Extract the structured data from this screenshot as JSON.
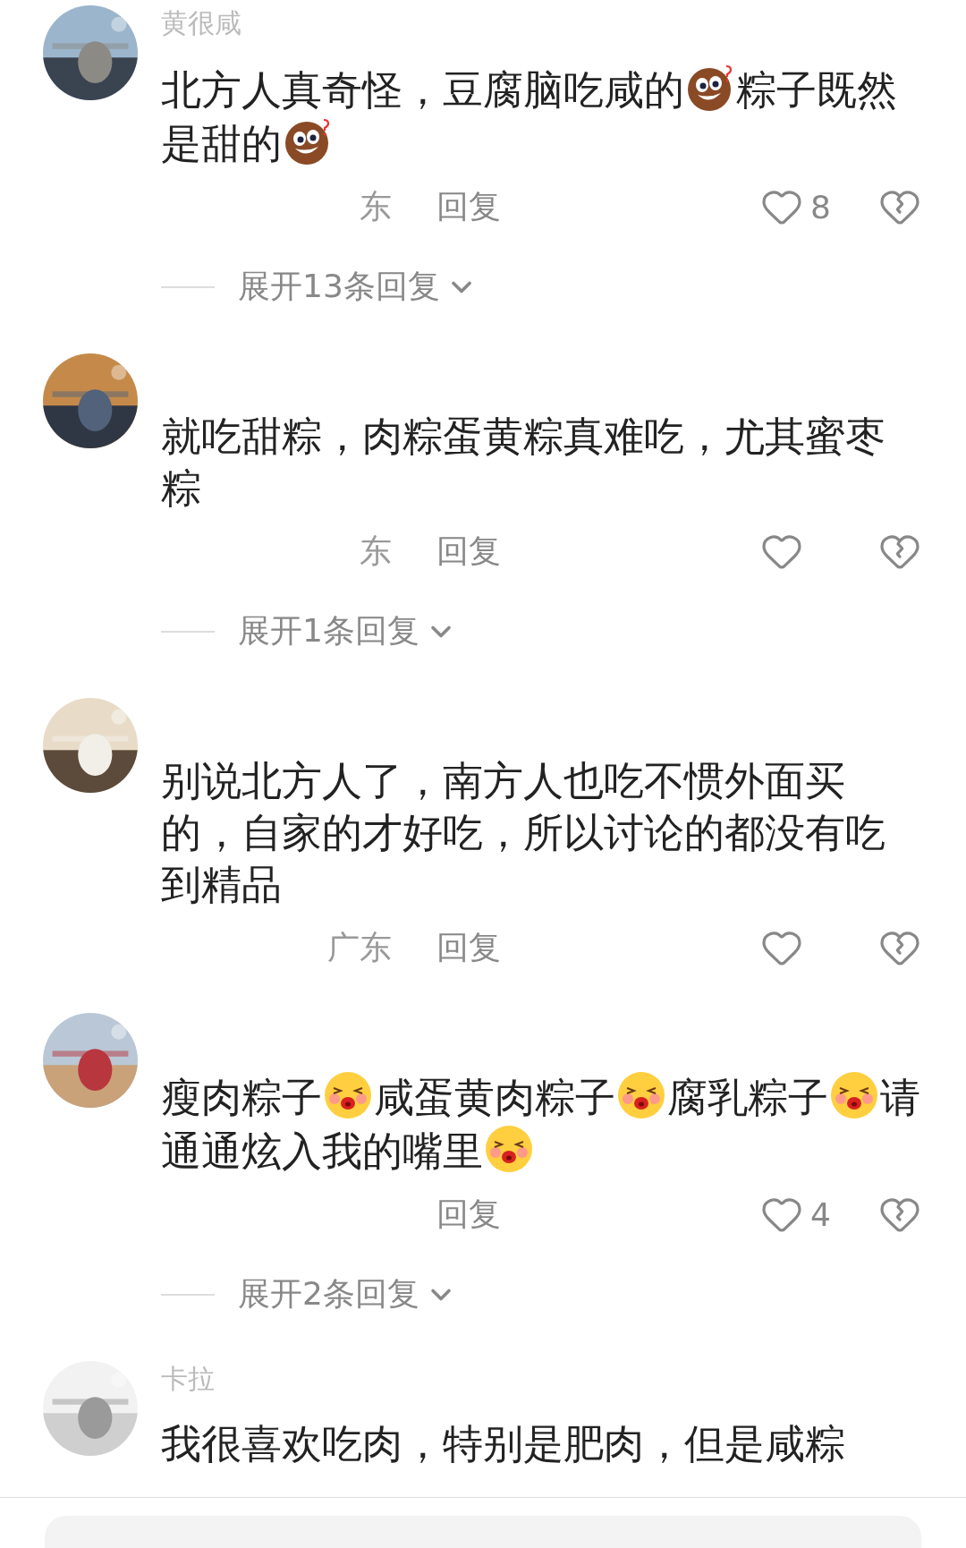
{
  "comments": [
    {
      "user": "黄很咸",
      "text": [
        {
          "kind": "text",
          "text": "北方人真奇怪，豆腐脑吃咸的"
        },
        {
          "kind": "puzzled"
        },
        {
          "kind": "text",
          "text": "粽子既然"
        },
        {
          "kind": "text",
          "text": "是甜的"
        },
        {
          "kind": "puzzled"
        }
      ],
      "location": "东",
      "reply": "回复",
      "likes": "8",
      "expand": "展开13条回复"
    },
    {
      "text": [
        {
          "kind": "text",
          "text": "就吃甜粽，肉粽蛋黄粽真难吃，尤其蜜枣粽"
        }
      ],
      "location": "东",
      "reply": "回复",
      "expand": "展开1条回复"
    },
    {
      "text": [
        {
          "kind": "text",
          "text": "别说北方人了，南方人也吃不惯外面买的，自家的才好吃，所以讨论的都没有吃到精品"
        }
      ],
      "location": "广东",
      "reply": "回复"
    },
    {
      "text": [
        {
          "kind": "text",
          "text": "瘦肉粽子"
        },
        {
          "kind": "kiss"
        },
        {
          "kind": "text",
          "text": "咸蛋黄肉粽子"
        },
        {
          "kind": "kiss"
        },
        {
          "kind": "text",
          "text": "腐乳粽子"
        },
        {
          "kind": "kiss"
        },
        {
          "kind": "text",
          "text": "请"
        },
        {
          "kind": "text",
          "text": "通通炫入我的嘴里"
        },
        {
          "kind": "kiss"
        }
      ],
      "reply": "回复",
      "likes": "4",
      "expand": "展开2条回复"
    },
    {
      "user": "卡拉",
      "text": [
        {
          "kind": "text",
          "text": "我很喜欢吃肉，特别是肥肉，但是咸粽"
        }
      ]
    }
  ]
}
